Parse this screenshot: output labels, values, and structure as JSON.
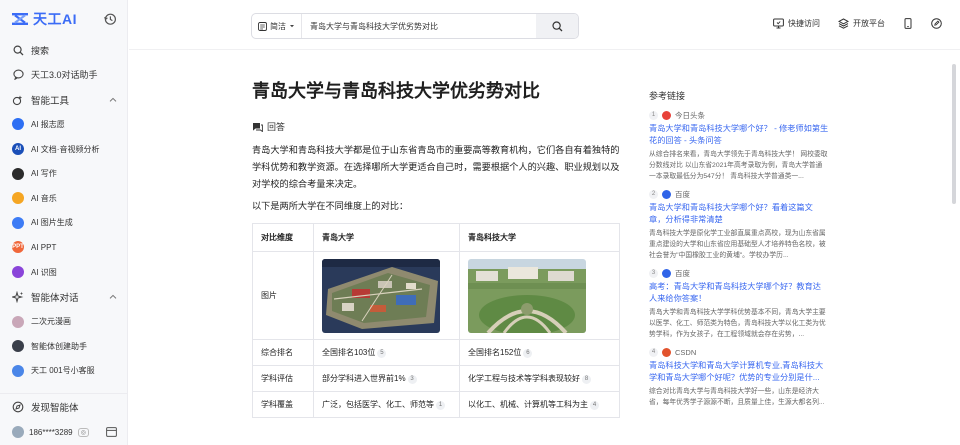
{
  "app": {
    "name": "天工AI"
  },
  "sidebar": {
    "search": "搜索",
    "assistant": "天工3.0对话助手",
    "tools_group": "智能工具",
    "tools": [
      {
        "label": "AI 报志愿",
        "color": "#2d6ff3",
        "mark": ""
      },
      {
        "label": "AI 文档·音视频分析",
        "color": "#1a4fb8",
        "mark": "AI"
      },
      {
        "label": "AI 写作",
        "color": "#2b2b2b",
        "mark": ""
      },
      {
        "label": "AI 音乐",
        "color": "#f5a623",
        "mark": ""
      },
      {
        "label": "AI 图片生成",
        "color": "#3d7cf5",
        "mark": ""
      },
      {
        "label": "AI PPT",
        "color": "#f0673a",
        "mark": "PPT"
      },
      {
        "label": "AI 识图",
        "color": "#8a45d9",
        "mark": ""
      }
    ],
    "agents_group": "智能体对话",
    "agents": [
      {
        "label": "二次元漫画",
        "color": "#c9a7b8"
      },
      {
        "label": "智能体创建助手",
        "color": "#3a3f4a"
      },
      {
        "label": "天工 001号小客服",
        "color": "#4a86e8"
      }
    ],
    "discover": "发现智能体",
    "user": "186****3289"
  },
  "search": {
    "scope": "简洁",
    "query": "青岛大学与青岛科技大学优劣势对比"
  },
  "top_actions": [
    "快捷访问",
    "开放平台"
  ],
  "answer": {
    "title": "青岛大学与青岛科技大学优劣势对比",
    "label": "回答",
    "intro": "青岛大学和青岛科技大学都是位于山东省青岛市的重要高等教育机构，它们各自有着独特的学科优势和教学资源。在选择哪所大学更适合自己时，需要根据个人的兴趣、职业规划以及对学校的综合考量来决定。",
    "sub_intro": "以下是两所大学在不同维度上的对比："
  },
  "table": {
    "headers": [
      "对比维度",
      "青岛大学",
      "青岛科技大学"
    ],
    "image_row_label": "图片",
    "rows": [
      {
        "dim": "综合排名",
        "a": "全国排名103位",
        "a_ref": "5",
        "b": "全国排名152位",
        "b_ref": "6"
      },
      {
        "dim": "学科评估",
        "a": "部分学科进入世界前1%",
        "a_ref": "3",
        "b": "化学工程与技术等学科表现较好",
        "b_ref": "8"
      },
      {
        "dim": "学科覆盖",
        "a": "广泛，包括医学、化工、师范等",
        "a_ref": "1",
        "b": "以化工、机械、计算机等工科为主",
        "b_ref": "4"
      }
    ]
  },
  "references": {
    "title": "参考链接",
    "items": [
      {
        "num": "1",
        "source": "今日头条",
        "icon_color": "#e8423a",
        "title": "青岛大学和青岛科技大学哪个好？ - 修老师如第生花的回答 - 头条问答",
        "snippet": "从综合排名来看，青岛大学领先于青岛科技大学！ 网校委取分数线对比 以山东省2021年高考录取为例，青岛大学普通一本录取最低分为547分！ 青岛科技大学普通类一..."
      },
      {
        "num": "2",
        "source": "百度",
        "icon_color": "#3064e8",
        "title": "青岛大学和青岛科技大学哪个好？看着这篇文章，分析得非常清楚",
        "snippet": "青岛科技大学是原化学工业部直属重点高校，现为山东省属重点建设的大学和山东省应用基础型人才培养特色名校，被社会誉为\"中国橡胶工业的黄埔\"。学校办学历..."
      },
      {
        "num": "3",
        "source": "百度",
        "icon_color": "#3064e8",
        "title": "高考：青岛大学和青岛科技大学哪个好？教育达人来给你答案！",
        "snippet": "青岛大学和青岛科技大学学科优势基本不同，青岛大学主要以医学、化工、师范类为特色，青岛科技大学以化工类为优势学科，作为女孩子，在工程领域就会存在劣势，..."
      },
      {
        "num": "4",
        "source": "CSDN",
        "icon_color": "#e2532d",
        "title": "青岛科技大学和青岛大学计算机专业,青岛科技大学和青岛大学哪个好呢？优势的专业分别是什...",
        "snippet": "综合对比青岛大学与青岛科技大学好一些，山东是经济大省，每年优秀学子源源不断，且质量上佳，生源大都名列..."
      }
    ]
  }
}
